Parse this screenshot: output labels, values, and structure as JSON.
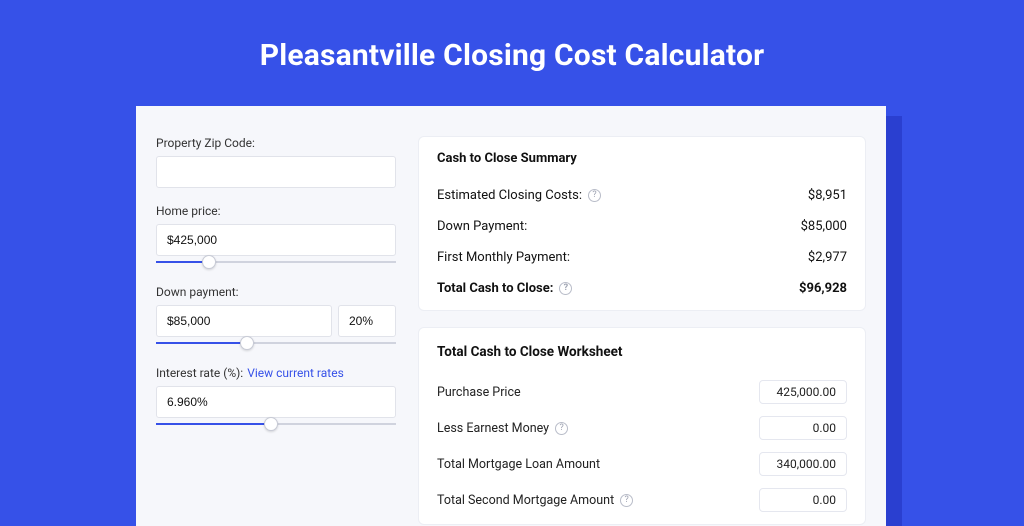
{
  "header": {
    "title": "Pleasantville Closing Cost Calculator"
  },
  "inputs": {
    "zip": {
      "label": "Property Zip Code:",
      "value": ""
    },
    "home_price": {
      "label": "Home price:",
      "value": "$425,000",
      "slider_pct": 22
    },
    "down_payment": {
      "label": "Down payment:",
      "value": "$85,000",
      "pct": "20%",
      "slider_pct": 38
    },
    "interest_rate": {
      "label": "Interest rate (%):",
      "link_text": "View current rates",
      "value": "6.960%",
      "slider_pct": 48
    }
  },
  "summary": {
    "title": "Cash to Close Summary",
    "rows": [
      {
        "label": "Estimated Closing Costs:",
        "help": true,
        "value": "$8,951",
        "bold": false
      },
      {
        "label": "Down Payment:",
        "help": false,
        "value": "$85,000",
        "bold": false
      },
      {
        "label": "First Monthly Payment:",
        "help": false,
        "value": "$2,977",
        "bold": false
      },
      {
        "label": "Total Cash to Close:",
        "help": true,
        "value": "$96,928",
        "bold": true
      }
    ]
  },
  "worksheet": {
    "title": "Total Cash to Close Worksheet",
    "rows": [
      {
        "label": "Purchase Price",
        "help": false,
        "value": "425,000.00"
      },
      {
        "label": "Less Earnest Money",
        "help": true,
        "value": "0.00"
      },
      {
        "label": "Total Mortgage Loan Amount",
        "help": false,
        "value": "340,000.00"
      },
      {
        "label": "Total Second Mortgage Amount",
        "help": true,
        "value": "0.00"
      }
    ]
  },
  "icons": {
    "help_glyph": "?"
  }
}
